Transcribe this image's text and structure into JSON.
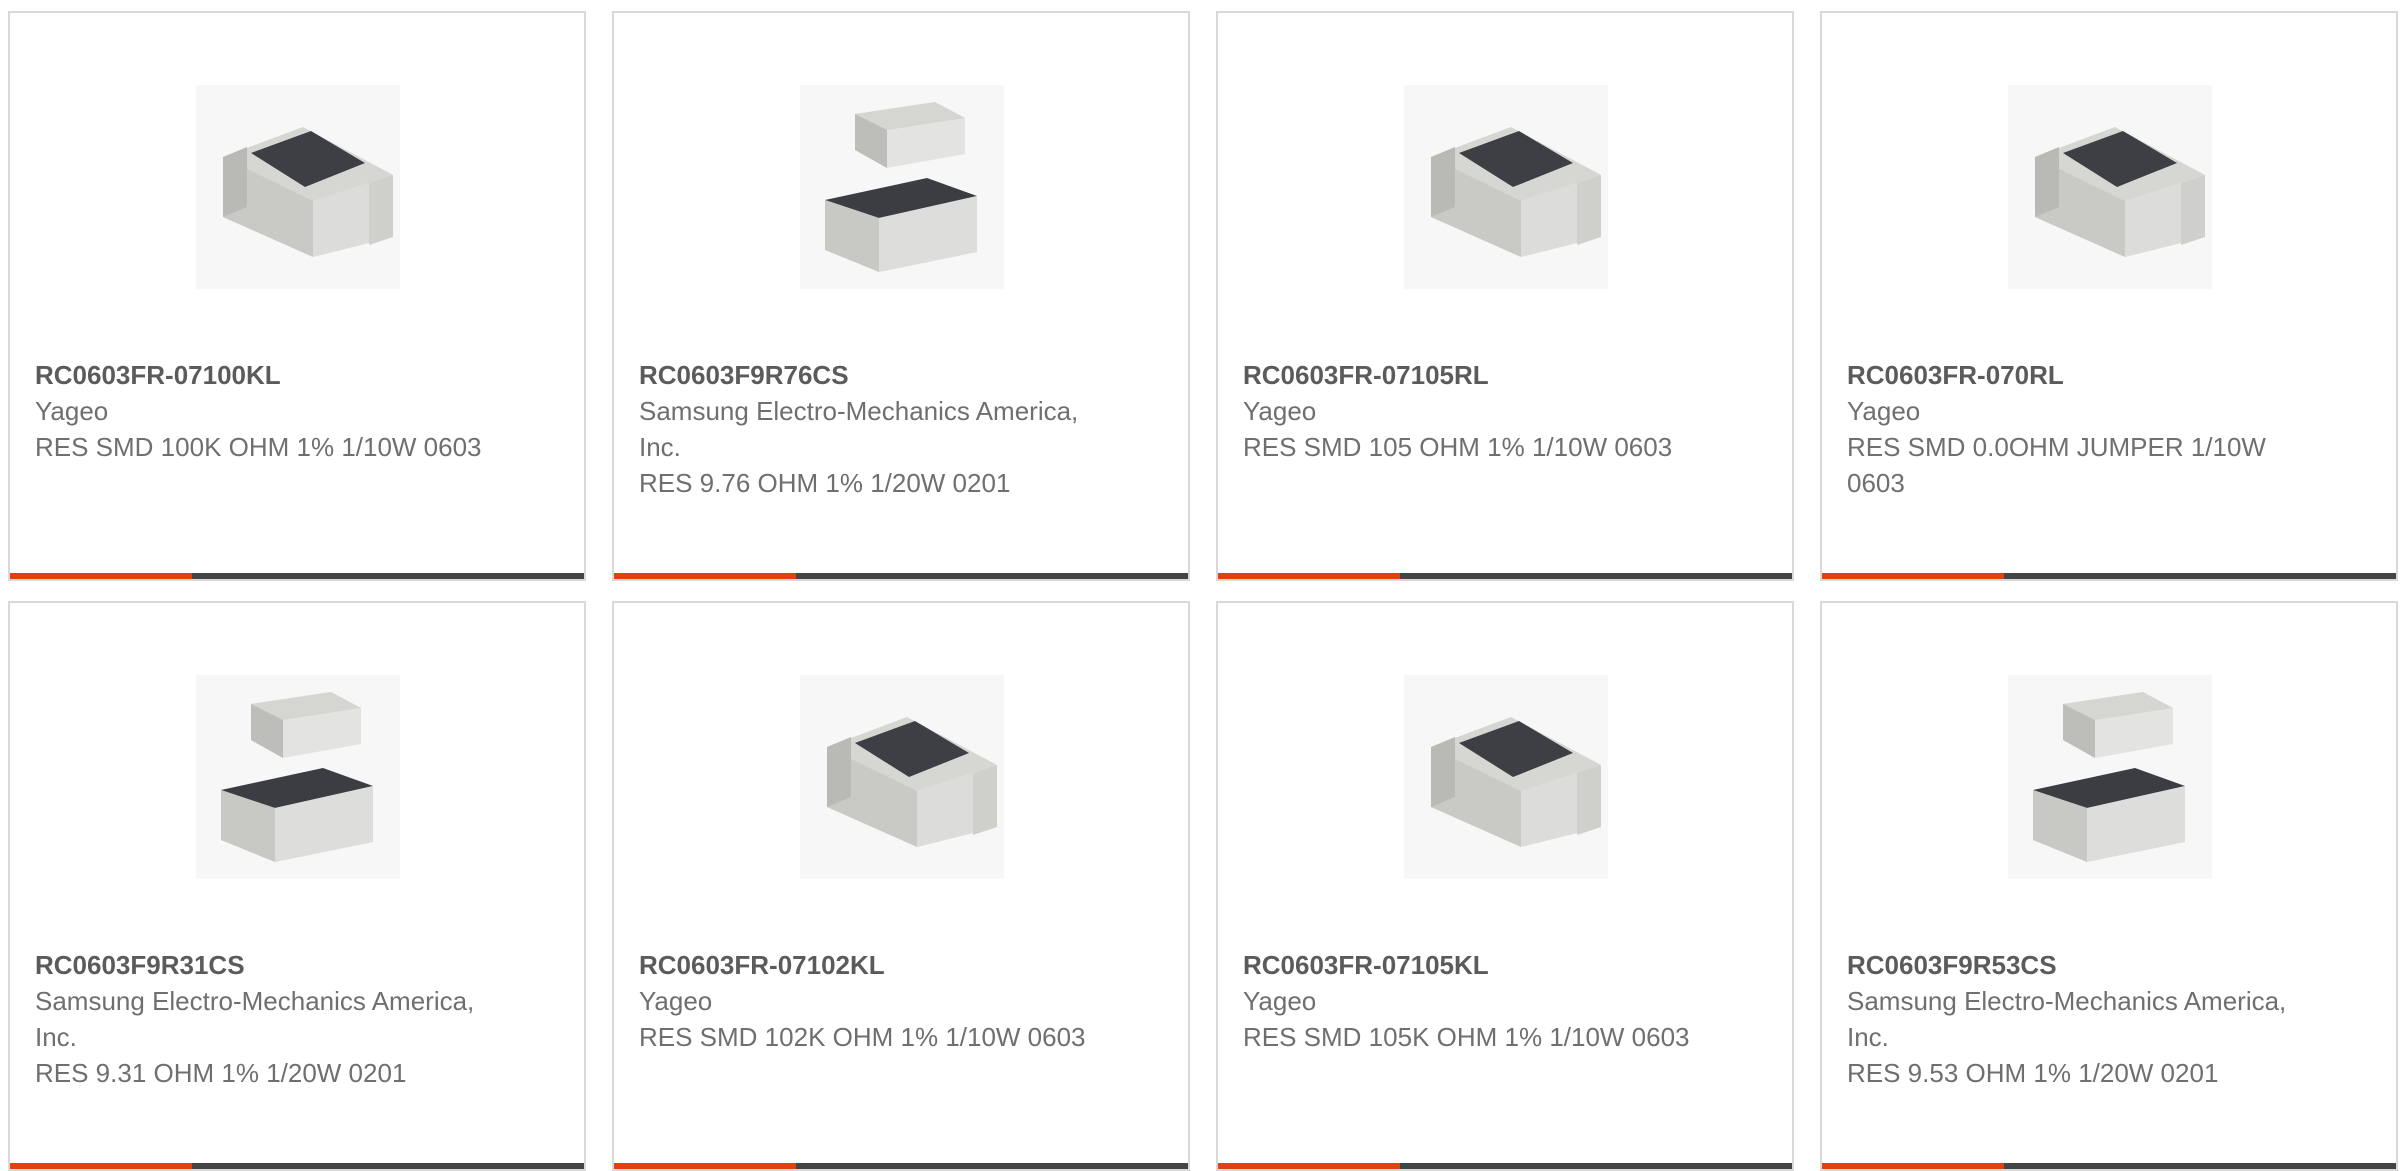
{
  "colors": {
    "accent": "#e2400e",
    "bar_dark": "#444444",
    "border": "#d9d9d9",
    "title_text": "#5b5b5b",
    "body_text": "#6f6f6f"
  },
  "products": [
    {
      "part_number": "RC0603FR-07100KL",
      "manufacturer": "Yageo",
      "description": "RES SMD 100K OHM 1% 1/10W 0603",
      "image": "resistor-chip-icon"
    },
    {
      "part_number": "RC0603F9R76CS",
      "manufacturer": "Samsung Electro-Mechanics America, Inc.",
      "description": "RES 9.76 OHM 1% 1/20W 0201",
      "image": "resistor-chip-pair-icon"
    },
    {
      "part_number": "RC0603FR-07105RL",
      "manufacturer": "Yageo",
      "description": "RES SMD 105 OHM 1% 1/10W 0603",
      "image": "resistor-chip-icon"
    },
    {
      "part_number": "RC0603FR-070RL",
      "manufacturer": "Yageo",
      "description": "RES SMD 0.0OHM JUMPER 1/10W 0603",
      "image": "resistor-chip-icon"
    },
    {
      "part_number": "RC0603F9R31CS",
      "manufacturer": "Samsung Electro-Mechanics America, Inc.",
      "description": "RES 9.31 OHM 1% 1/20W 0201",
      "image": "resistor-chip-pair-icon"
    },
    {
      "part_number": "RC0603FR-07102KL",
      "manufacturer": "Yageo",
      "description": "RES SMD 102K OHM 1% 1/10W 0603",
      "image": "resistor-chip-icon"
    },
    {
      "part_number": "RC0603FR-07105KL",
      "manufacturer": "Yageo",
      "description": "RES SMD 105K OHM 1% 1/10W 0603",
      "image": "resistor-chip-icon"
    },
    {
      "part_number": "RC0603F9R53CS",
      "manufacturer": "Samsung Electro-Mechanics America, Inc.",
      "description": "RES 9.53 OHM 1% 1/20W 0201",
      "image": "resistor-chip-pair-icon"
    }
  ]
}
